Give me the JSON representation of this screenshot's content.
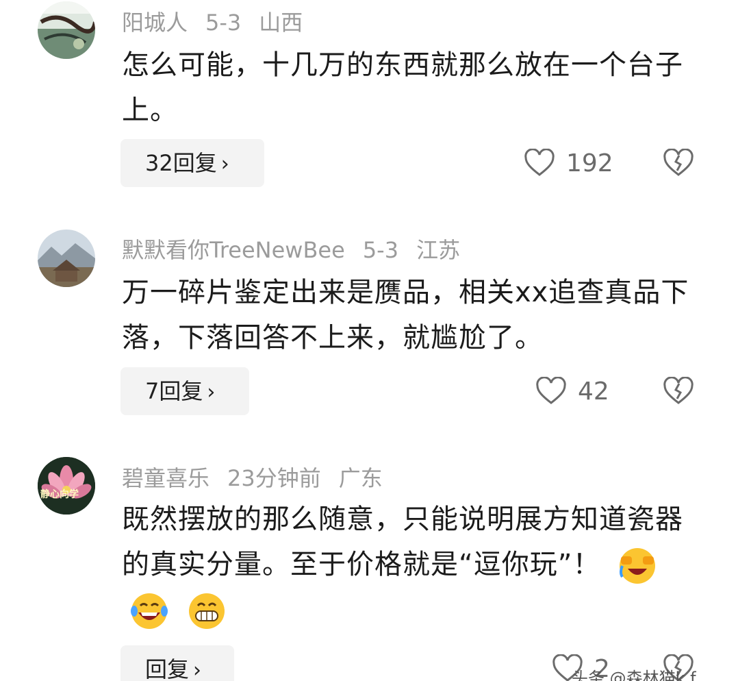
{
  "comments": [
    {
      "username": "阳城人",
      "date": "5-3",
      "location": "山西",
      "text": "怎么可能，十几万的东西就那么放在一个台子上。",
      "reply_label": "32回复",
      "likes": "192"
    },
    {
      "username": "默默看你TreeNewBee",
      "date": "5-3",
      "location": "江苏",
      "text": "万一碎片鉴定出来是赝品，相关xx追查真品下落，下落回答不上来，就尴尬了。",
      "reply_label": "7回复",
      "likes": "42"
    },
    {
      "username": "碧童喜乐",
      "date": "23分钟前",
      "location": "广东",
      "text": "既然摆放的那么随意，只能说明展方知道瓷器的真实分量。至于价格就是“逗你玩”！",
      "avatar_text": "静心向学",
      "reply_label": "回复",
      "likes": "2"
    }
  ],
  "watermark": "头条 @森林猫k f",
  "icons": {
    "like": "heart-outline-icon",
    "dislike": "broken-heart-icon",
    "chevron": "chevron-right-icon",
    "emojis": [
      "laughing-crying-emoji",
      "tears-of-joy-emoji",
      "grinning-emoji"
    ]
  },
  "colors": {
    "meta_text": "#9b9b9b",
    "reply_bg": "#f3f3f3",
    "icon_gray": "#6b6b6b"
  }
}
